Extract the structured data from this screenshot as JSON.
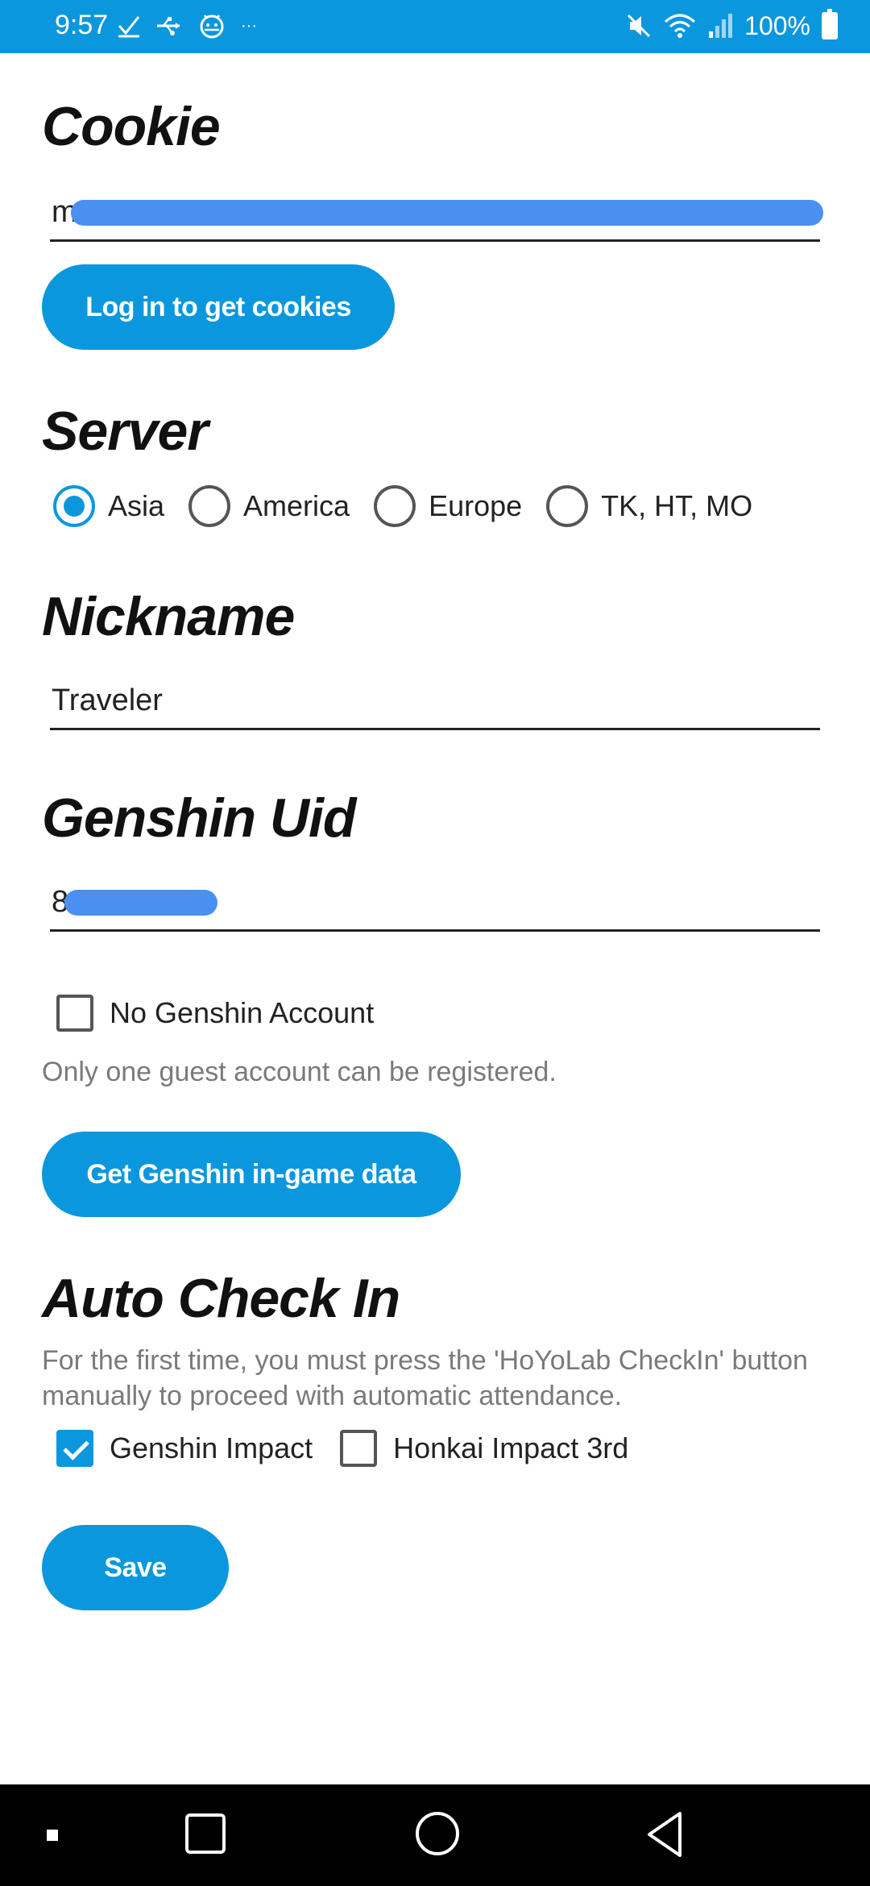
{
  "status_bar": {
    "time": "9:57",
    "battery": "100%",
    "left_icons": [
      "check-icon",
      "usb-icon",
      "android-debug-icon",
      "more-icon"
    ],
    "right_icons": [
      "mute-icon",
      "wifi-icon",
      "signal-icon",
      "battery-icon"
    ]
  },
  "cookie": {
    "heading": "Cookie",
    "value_visible": "m",
    "login_button": "Log in to get cookies"
  },
  "server": {
    "heading": "Server",
    "options": [
      "Asia",
      "America",
      "Europe",
      "TK, HT, MO"
    ],
    "selected": "Asia"
  },
  "nickname": {
    "heading": "Nickname",
    "value": "Traveler"
  },
  "uid": {
    "heading": "Genshin Uid",
    "value_visible": "8"
  },
  "guest": {
    "checkbox_label": "No Genshin Account",
    "checked": false,
    "helper": "Only one guest account can be registered.",
    "button": "Get Genshin in-game data"
  },
  "auto_checkin": {
    "heading": "Auto Check In",
    "helper": "For the first time, you must press the 'HoYoLab CheckIn' button manually to proceed with automatic attendance.",
    "options": [
      {
        "label": "Genshin Impact",
        "checked": true
      },
      {
        "label": "Honkai Impact 3rd",
        "checked": false
      }
    ]
  },
  "save_button": "Save",
  "colors": {
    "accent": "#0a97dd",
    "redaction": "#4a90f0",
    "nav_bar": "#000000"
  }
}
